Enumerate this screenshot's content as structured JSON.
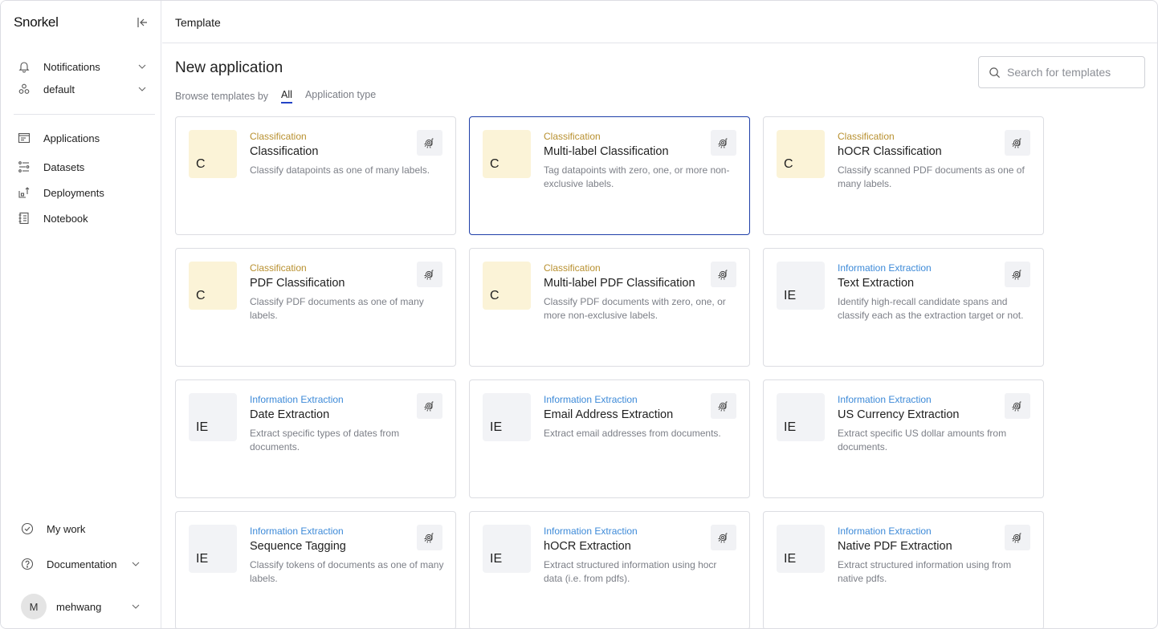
{
  "app": {
    "logo": "Snorkel"
  },
  "sidebar": {
    "top_items": [
      {
        "label": "Notifications",
        "icon": "bell-icon"
      },
      {
        "label": "default",
        "icon": "workspace-icon"
      }
    ],
    "nav_items": [
      {
        "label": "Applications",
        "icon": "applications-icon"
      },
      {
        "label": "Datasets",
        "icon": "datasets-icon"
      },
      {
        "label": "Deployments",
        "icon": "deployments-icon"
      },
      {
        "label": "Notebook",
        "icon": "notebook-icon"
      }
    ],
    "bottom_items": [
      {
        "label": "My work",
        "icon": "check-circle-icon"
      },
      {
        "label": "Documentation",
        "icon": "help-circle-icon"
      }
    ],
    "user": {
      "initial": "M",
      "name": "mehwang"
    }
  },
  "header": {
    "title": "Template"
  },
  "main": {
    "title": "New application",
    "browse_label": "Browse templates by",
    "tabs": [
      {
        "label": "All",
        "active": true
      },
      {
        "label": "Application type",
        "active": false
      }
    ],
    "search": {
      "placeholder": "Search for templates",
      "value": ""
    }
  },
  "colors": {
    "accent": "#2343c6",
    "classification": "#b8902f",
    "information_extraction": "#3d8ad8",
    "classification_badge_bg": "#fbf3d7",
    "ie_badge_bg": "#f2f3f6"
  },
  "templates": [
    {
      "badge": "C",
      "type": "Classification",
      "name": "Classification",
      "desc": "Classify datapoints as one of many labels."
    },
    {
      "badge": "C",
      "type": "Classification",
      "name": "Multi-label Classification",
      "desc": "Tag datapoints with zero, one, or more non-exclusive labels.",
      "selected": true
    },
    {
      "badge": "C",
      "type": "Classification",
      "name": "hOCR Classification",
      "desc": "Classify scanned PDF documents as one of many labels."
    },
    {
      "badge": "C",
      "type": "Classification",
      "name": "PDF Classification",
      "desc": "Classify PDF documents as one of many labels."
    },
    {
      "badge": "C",
      "type": "Classification",
      "name": "Multi-label PDF Classification",
      "desc": "Classify PDF documents with zero, one, or more non-exclusive labels."
    },
    {
      "badge": "IE",
      "type": "Information Extraction",
      "name": "Text Extraction",
      "desc": "Identify high-recall candidate spans and classify each as the extraction target or not."
    },
    {
      "badge": "IE",
      "type": "Information Extraction",
      "name": "Date Extraction",
      "desc": "Extract specific types of dates from documents."
    },
    {
      "badge": "IE",
      "type": "Information Extraction",
      "name": "Email Address Extraction",
      "desc": "Extract email addresses from documents."
    },
    {
      "badge": "IE",
      "type": "Information Extraction",
      "name": "US Currency Extraction",
      "desc": "Extract specific US dollar amounts from documents."
    },
    {
      "badge": "IE",
      "type": "Information Extraction",
      "name": "Sequence Tagging",
      "desc": "Classify tokens of documents as one of many labels."
    },
    {
      "badge": "IE",
      "type": "Information Extraction",
      "name": "hOCR Extraction",
      "desc": "Extract structured information using hocr data (i.e. from pdfs)."
    },
    {
      "badge": "IE",
      "type": "Information Extraction",
      "name": "Native PDF Extraction",
      "desc": "Extract structured information using from native pdfs."
    }
  ]
}
